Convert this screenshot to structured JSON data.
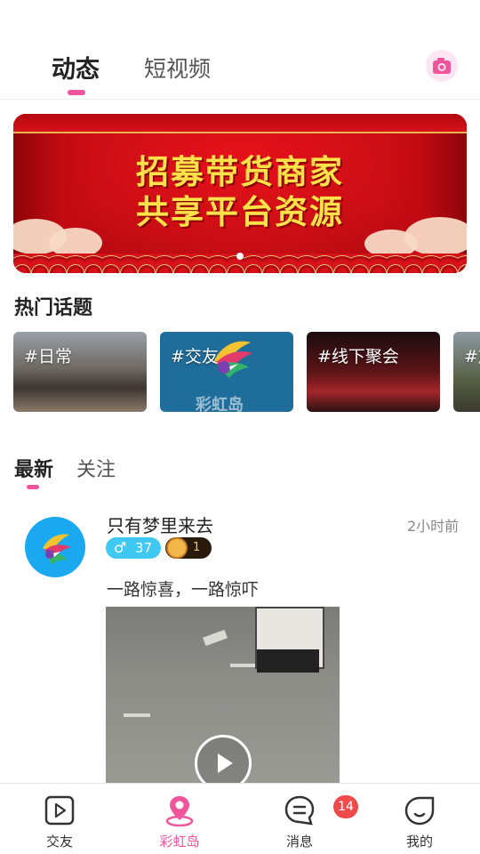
{
  "header": {
    "tabs": [
      {
        "label": "动态",
        "active": true
      },
      {
        "label": "短视频",
        "active": false
      }
    ],
    "camera_icon": "camera-icon",
    "accent_color": "#f0559b"
  },
  "banner": {
    "line1": "招募带货商家",
    "line2": "共享平台资源",
    "page_indicator": {
      "current": 1,
      "total": 1
    }
  },
  "hot_topics": {
    "title": "热门话题",
    "items": [
      {
        "label": "#日常"
      },
      {
        "label": "#交友"
      },
      {
        "label": "#线下聚会"
      },
      {
        "label": "#旅"
      }
    ]
  },
  "feed": {
    "tabs": [
      {
        "label": "最新",
        "active": true
      },
      {
        "label": "关注",
        "active": false
      }
    ],
    "posts": [
      {
        "username": "只有梦里来去",
        "time": "2小时前",
        "gender_symbol": "♂",
        "age": "37",
        "level": "1",
        "text": "一路惊喜，一路惊吓",
        "media": "video"
      }
    ]
  },
  "bottom_nav": {
    "items": [
      {
        "label": "交友",
        "icon": "play-square-icon",
        "active": false
      },
      {
        "label": "彩虹岛",
        "icon": "location-pin-icon",
        "active": true
      },
      {
        "label": "消息",
        "icon": "chat-bubble-icon",
        "active": false,
        "badge": "14"
      },
      {
        "label": "我的",
        "icon": "smile-face-icon",
        "active": false
      }
    ]
  }
}
